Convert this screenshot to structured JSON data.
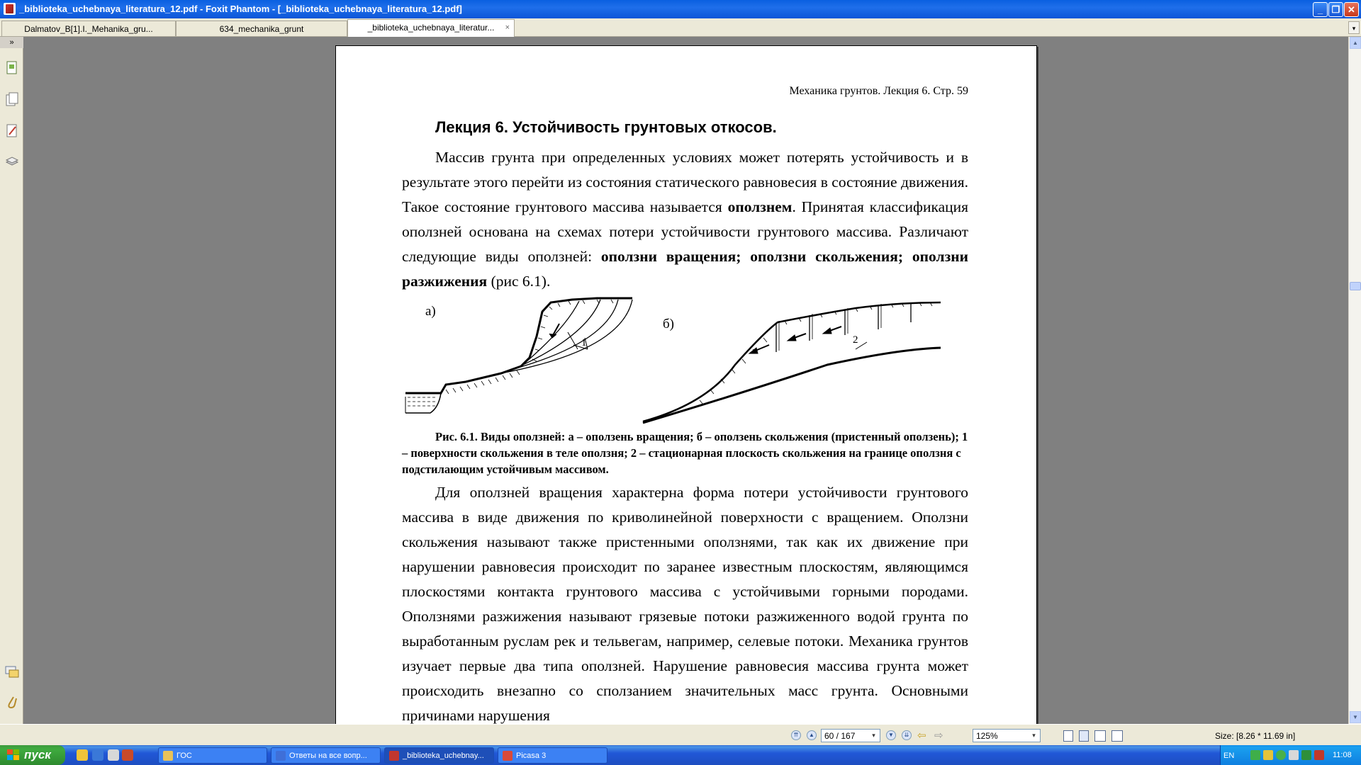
{
  "window": {
    "title": "_biblioteka_uchebnaya_literatura_12.pdf - Foxit Phantom - [_biblioteka_uchebnaya_literatura_12.pdf]",
    "minimize": "_",
    "maximize": "❐",
    "close": "✕"
  },
  "tabs": [
    {
      "label": "Dalmatov_B[1].I._Mehanika_gru..."
    },
    {
      "label": "634_mechanika_grunt"
    },
    {
      "label": "_biblioteka_uchebnaya_literatur...",
      "close": "×"
    }
  ],
  "tab_menu": "▾",
  "left_panel": {
    "collapse": "»",
    "icons": [
      "pages-icon",
      "bookmarks-icon",
      "comments-icon",
      "layers-icon",
      "annotations-icon",
      "attachments-icon"
    ]
  },
  "page": {
    "running_head": "Механика грунтов. Лекция 6. Стр. 59",
    "heading": "Лекция 6. Устойчивость грунтовых откосов.",
    "p1": {
      "t1": "Массив грунта при определенных условиях может потерять устойчивость и в результате этого перейти из состояния статического равновесия в состояние движения. Такое состояние грунтового массива называется ",
      "b1": "оползнем",
      "t2": ". Принятая классификация оползней основана на схемах потери устойчивости грунтового массива. Различают следующие виды оползней: ",
      "b2": "оползни вращения; оползни скольжения; оползни разжижения",
      "t3": " (рис 6.1)."
    },
    "figure": {
      "label_a": "а)",
      "label_b": "б)",
      "mark_1": "1",
      "mark_2": "2"
    },
    "caption": "Рис. 6.1. Виды оползней: а – оползень вращения; б – оползень скольжения (пристенный оползень); 1 – поверхности скольжения в теле оползня; 2 – стационарная плоскость скольжения на границе оползня с подстилающим устойчивым массивом.",
    "p2": "Для оползней вращения характерна форма потери устойчивости грунтового массива в виде движения по криволинейной поверхности с вращением. Оползни скольжения называют также пристенными оползнями, так как их движение при нарушении равновесия происходит по заранее известным плоскостям, являющимся плоскостями контакта грунтового массива с устойчивыми горными породами. Оползнями разжижения называют грязевые потоки разжиженного водой грунта по выработанным руслам рек и тельвегам, например, селевые потоки. Механика грунтов изучает первые два типа оползней. Нарушение равновесия массива грунта может происходить внезапно со сползанием значительных масс грунта. Основными причинами нарушения"
  },
  "scrollbar": {
    "up": "▲",
    "down": "▼"
  },
  "statusbar": {
    "page_field": "60 / 167",
    "zoom_field": "125%",
    "dropdown": "▾",
    "size": "Size: [8.26 * 11.69 in]",
    "nav": [
      "⇈",
      "▲",
      "▼",
      "⇊"
    ],
    "back": "⇦",
    "forward": "⇨"
  },
  "taskbar": {
    "start": "пуск",
    "tasks": [
      {
        "label": "ГОС",
        "color": "#e8c25a"
      },
      {
        "label": "Ответы на все вопр...",
        "color": "#3f6fd8"
      },
      {
        "label": "_biblioteka_uchebnay...",
        "color": "#c2372e",
        "active": true
      },
      {
        "label": "Picasa 3",
        "color": "#d94a3a"
      }
    ],
    "lang": "EN",
    "clock": "11:08"
  }
}
